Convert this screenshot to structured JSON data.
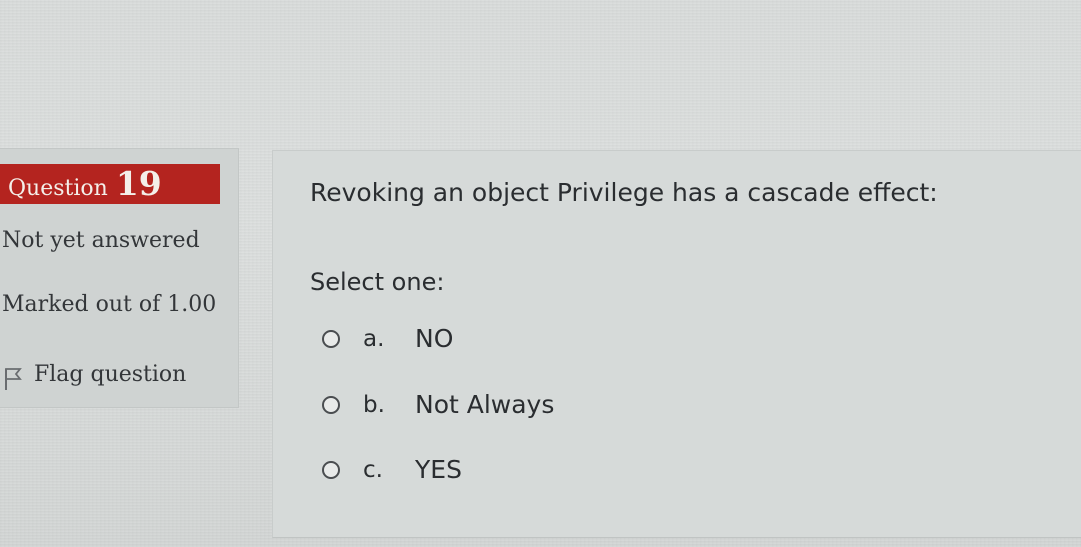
{
  "question": {
    "label": "Question",
    "number": "19",
    "state": "Not yet answered",
    "grade": "Marked out of 1.00",
    "flag_label": "Flag question",
    "text": "Revoking an object Privilege has a cascade effect:",
    "prompt": "Select one:",
    "options": [
      {
        "letter": "a.",
        "text": "NO"
      },
      {
        "letter": "b.",
        "text": "Not Always"
      },
      {
        "letter": "c.",
        "text": "YES"
      }
    ]
  },
  "colors": {
    "header_bg": "#b4241f",
    "header_text": "#f4efe9",
    "panel_bg": "#cfd3d2",
    "content_bg": "#d6dad9"
  },
  "icons": {
    "flag": "flag-icon",
    "radio": "radio-button-icon"
  }
}
